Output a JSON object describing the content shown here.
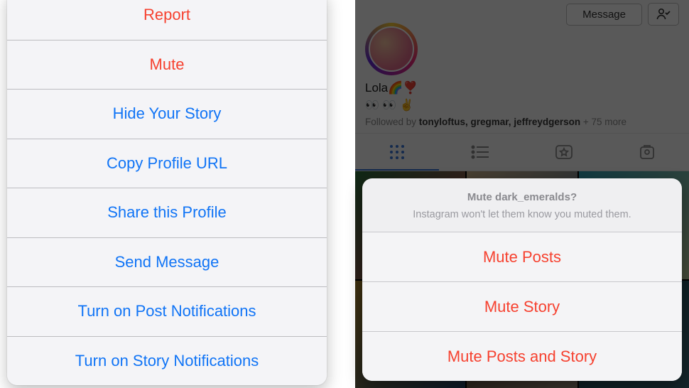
{
  "left_sheet": {
    "items": [
      {
        "label": "Report",
        "style": "red"
      },
      {
        "label": "Mute",
        "style": "red"
      },
      {
        "label": "Hide Your Story",
        "style": "blue"
      },
      {
        "label": "Copy Profile URL",
        "style": "blue"
      },
      {
        "label": "Share this Profile",
        "style": "blue"
      },
      {
        "label": "Send Message",
        "style": "blue"
      },
      {
        "label": "Turn on Post Notifications",
        "style": "blue"
      },
      {
        "label": "Turn on Story Notifications",
        "style": "blue"
      }
    ]
  },
  "right_profile": {
    "message_button": "Message",
    "display_name": "Lola🌈❣️",
    "emoji_line": "👀 👀 ✌️",
    "followed_prefix": "Followed by ",
    "followed_names": "tonyloftus, gregmar, jeffreydgerson",
    "followed_suffix": " + 75 more"
  },
  "right_sheet": {
    "title": "Mute dark_emeralds?",
    "subtitle": "Instagram won't let them know you muted them.",
    "items": [
      {
        "label": "Mute Posts"
      },
      {
        "label": "Mute Story"
      },
      {
        "label": "Mute Posts and Story"
      }
    ]
  }
}
